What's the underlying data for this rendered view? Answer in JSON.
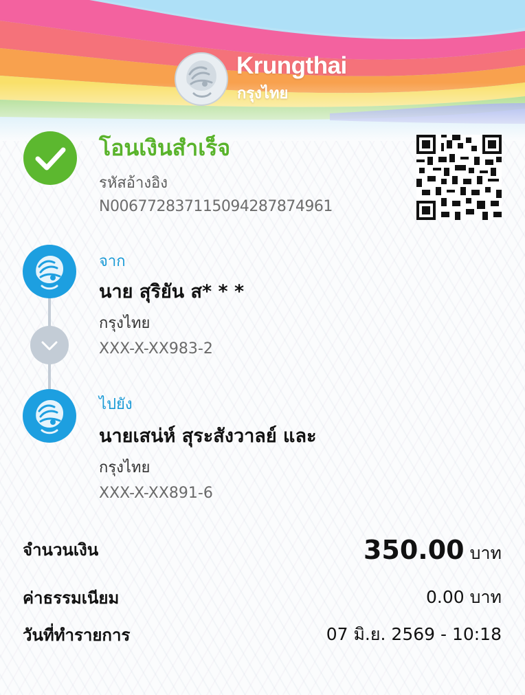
{
  "brand": {
    "name_en": "Krungthai",
    "name_th": "กรุงไทย"
  },
  "status": {
    "title": "โอนเงินสำเร็จ",
    "ref_label": "รหัสอ้างอิง",
    "ref_code": "N006772837115094287874961"
  },
  "from": {
    "label": "จาก",
    "name": "นาย สุริยัน ส* * *",
    "bank": "กรุงไทย",
    "account": "XXX-X-XX983-2"
  },
  "to": {
    "label": "ไปยัง",
    "name": "นายเสน่ห์ สุระสังวาลย์ และ",
    "bank": "กรุงไทย",
    "account": "XXX-X-XX891-6"
  },
  "summary": {
    "amount_label": "จำนวนเงิน",
    "amount_value": "350.00",
    "amount_unit": "บาท",
    "fee_label": "ค่าธรรมเนียม",
    "fee_value": "0.00 บาท",
    "date_label": "วันที่ทำรายการ",
    "date_value": "07 มิ.ย. 2569 - 10:18"
  },
  "colors": {
    "success_green": "#59b32b",
    "brand_blue": "#1d9fe0",
    "section_label_blue": "#1a9ad6"
  },
  "icons": {
    "success": "check-circle-icon",
    "bank": "krungthai-bird-icon",
    "arrow": "chevron-down-icon",
    "qr": "qr-code-icon"
  }
}
